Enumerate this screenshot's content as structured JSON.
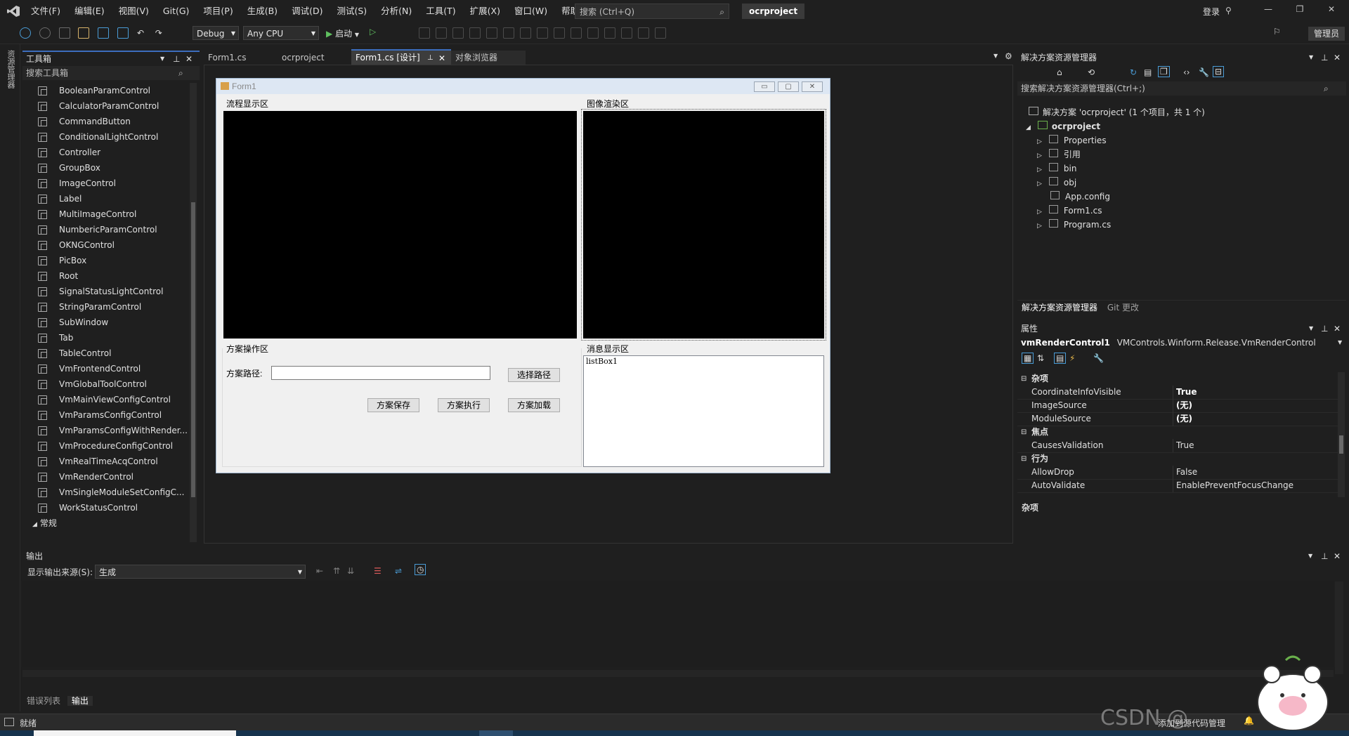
{
  "menu": [
    "文件(F)",
    "编辑(E)",
    "视图(V)",
    "Git(G)",
    "项目(P)",
    "生成(B)",
    "调试(D)",
    "测试(S)",
    "分析(N)",
    "工具(T)",
    "扩展(X)",
    "窗口(W)",
    "帮助(H)"
  ],
  "search": {
    "placeholder": "搜索 (Ctrl+Q)"
  },
  "project_name": "ocrproject",
  "login": "登录",
  "admin": "管理员",
  "toolbar": {
    "config": "Debug",
    "platform": "Any CPU",
    "start": "启动"
  },
  "side_strip": "资源管理器",
  "toolbox": {
    "title": "工具箱",
    "search_placeholder": "搜索工具箱",
    "items": [
      "BooleanParamControl",
      "CalculatorParamControl",
      "CommandButton",
      "ConditionalLightControl",
      "Controller",
      "GroupBox",
      "ImageControl",
      "Label",
      "MultiImageControl",
      "NumbericParamControl",
      "OKNGControl",
      "PicBox",
      "Root",
      "SignalStatusLightControl",
      "StringParamControl",
      "SubWindow",
      "Tab",
      "TableControl",
      "VmFrontendControl",
      "VmGlobalToolControl",
      "VmMainViewConfigControl",
      "VmParamsConfigControl",
      "VmParamsConfigWithRender...",
      "VmProcedureConfigControl",
      "VmRealTimeAcqControl",
      "VmRenderControl",
      "VmSingleModuleSetConfigC...",
      "WorkStatusControl"
    ],
    "group_footer": "常规"
  },
  "doc_tabs": [
    "Form1.cs",
    "ocrproject",
    "Form1.cs [设计]",
    "对象浏览器"
  ],
  "form": {
    "caption": "Form1",
    "flow_area": "流程显示区",
    "image_area": "图像渲染区",
    "scheme_area": "方案操作区",
    "message_area": "消息显示区",
    "path_label": "方案路径:",
    "path_value": "",
    "select_path": "选择路径",
    "save": "方案保存",
    "execute": "方案执行",
    "load": "方案加载",
    "listbox": "listBox1"
  },
  "solution_explorer": {
    "title": "解决方案资源管理器",
    "search": "搜索解决方案资源管理器(Ctrl+;)",
    "solution": "解决方案 'ocrproject' (1 个项目，共 1 个)",
    "project": "ocrproject",
    "nodes": [
      "Properties",
      "引用",
      "bin",
      "obj",
      "App.config",
      "Form1.cs",
      "Program.cs"
    ],
    "bottom_tabs": [
      "解决方案资源管理器",
      "Git 更改"
    ]
  },
  "properties": {
    "title": "属性",
    "object": "vmRenderControl1",
    "object_type": "VMControls.Winform.Release.VmRenderControl",
    "rows": [
      {
        "kind": "cat",
        "k": "杂项"
      },
      {
        "kind": "prop",
        "k": "CoordinateInfoVisible",
        "v": "True",
        "bold": true
      },
      {
        "kind": "prop",
        "k": "ImageSource",
        "v": "(无)",
        "bold": true
      },
      {
        "kind": "prop",
        "k": "ModuleSource",
        "v": "(无)",
        "bold": true
      },
      {
        "kind": "cat",
        "k": "焦点"
      },
      {
        "kind": "prop",
        "k": "CausesValidation",
        "v": "True"
      },
      {
        "kind": "cat",
        "k": "行为"
      },
      {
        "kind": "prop",
        "k": "AllowDrop",
        "v": "False"
      },
      {
        "kind": "prop",
        "k": "AutoValidate",
        "v": "EnablePreventFocusChange"
      }
    ],
    "desc": "杂项"
  },
  "output": {
    "title": "输出",
    "source_label": "显示输出来源(S):",
    "source_value": "生成",
    "tabs": [
      "错误列表",
      "输出"
    ]
  },
  "status": {
    "ready": "就绪",
    "source_control": "添加到源代码管理",
    "watermark": "CSDN @"
  }
}
